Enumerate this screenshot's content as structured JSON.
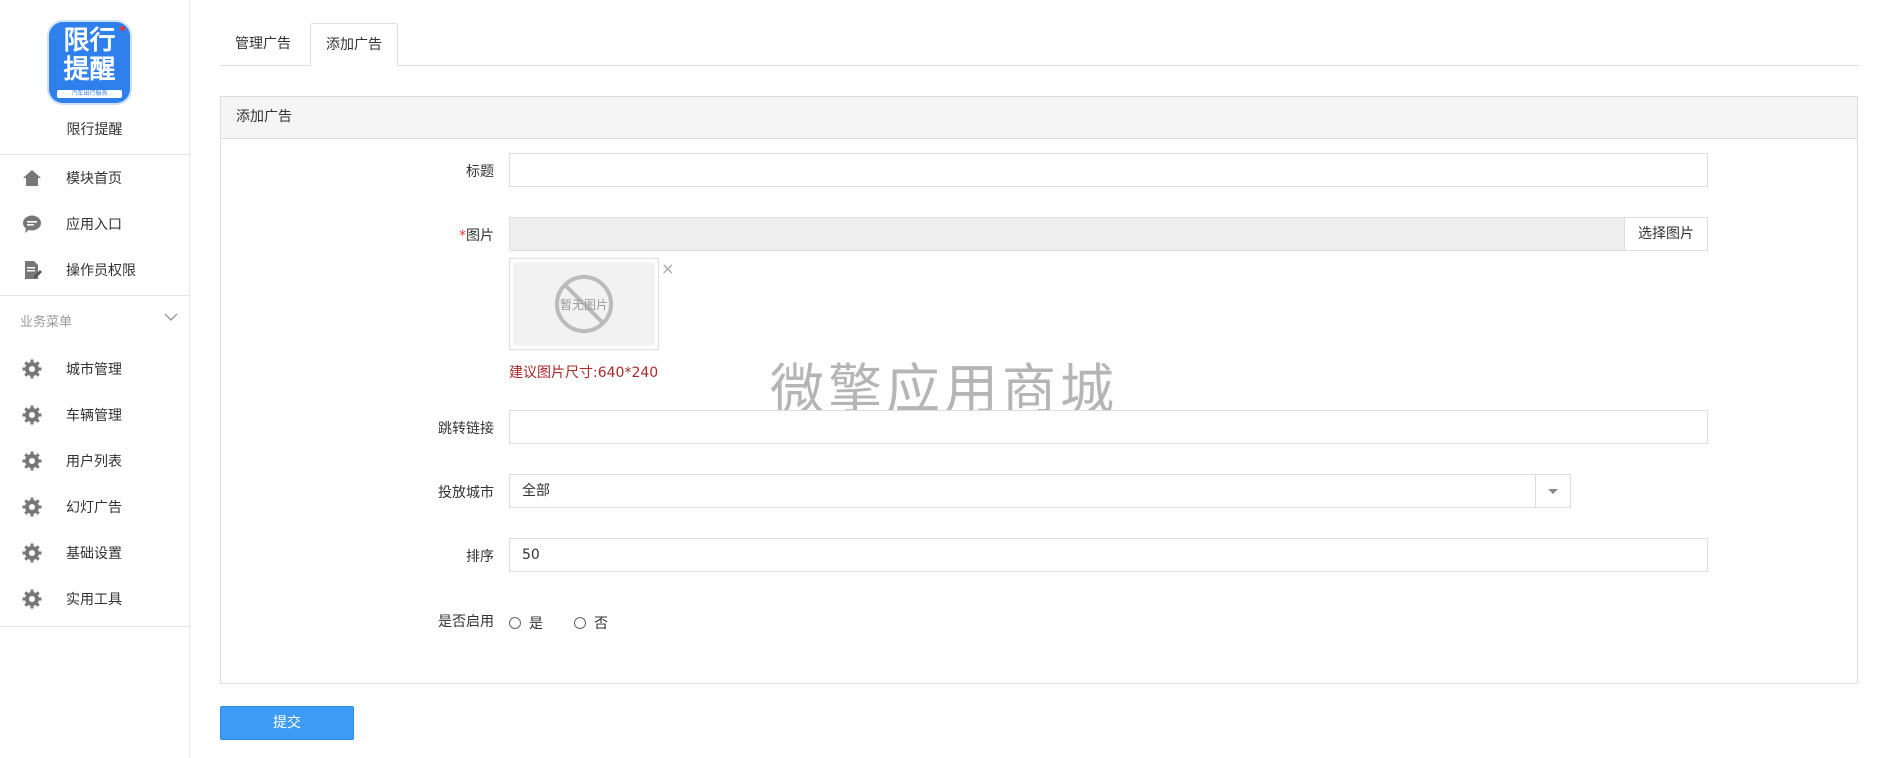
{
  "sidebar": {
    "logo": {
      "line1": "限行",
      "line2": "提醒",
      "band": "汽车出行服务"
    },
    "app_name": "限行提醒",
    "top_items": [
      {
        "label": "模块首页",
        "icon": "home-icon"
      },
      {
        "label": "应用入口",
        "icon": "chat-icon"
      },
      {
        "label": "操作员权限",
        "icon": "edit-doc-icon"
      }
    ],
    "group_title": "业务菜单",
    "group_items": [
      {
        "label": "城市管理",
        "icon": "gear-icon"
      },
      {
        "label": "车辆管理",
        "icon": "gear-icon"
      },
      {
        "label": "用户列表",
        "icon": "gear-icon"
      },
      {
        "label": "幻灯广告",
        "icon": "gear-icon"
      },
      {
        "label": "基础设置",
        "icon": "gear-icon"
      },
      {
        "label": "实用工具",
        "icon": "gear-icon"
      }
    ]
  },
  "tabs": [
    {
      "label": "管理广告",
      "active": false
    },
    {
      "label": "添加广告",
      "active": true
    }
  ],
  "panel": {
    "title": "添加广告",
    "fields": {
      "title_label": "标题",
      "title_value": "",
      "image_label": "图片",
      "image_required_mark": "*",
      "image_button": "选择图片",
      "image_placeholder_text": "暂无图片",
      "image_close": "×",
      "image_hint": "建议图片尺寸:640*240",
      "link_label": "跳转链接",
      "link_value": "",
      "city_label": "投放城市",
      "city_value": "全部",
      "sort_label": "排序",
      "sort_value": "50",
      "enable_label": "是否启用",
      "enable_yes": "是",
      "enable_no": "否"
    }
  },
  "watermark": "微擎应用商城",
  "submit_label": "提交",
  "colors": {
    "accent": "#3b9bf5",
    "logo": "#2f80ed",
    "hint": "#a52a2a",
    "required": "#e53935"
  }
}
